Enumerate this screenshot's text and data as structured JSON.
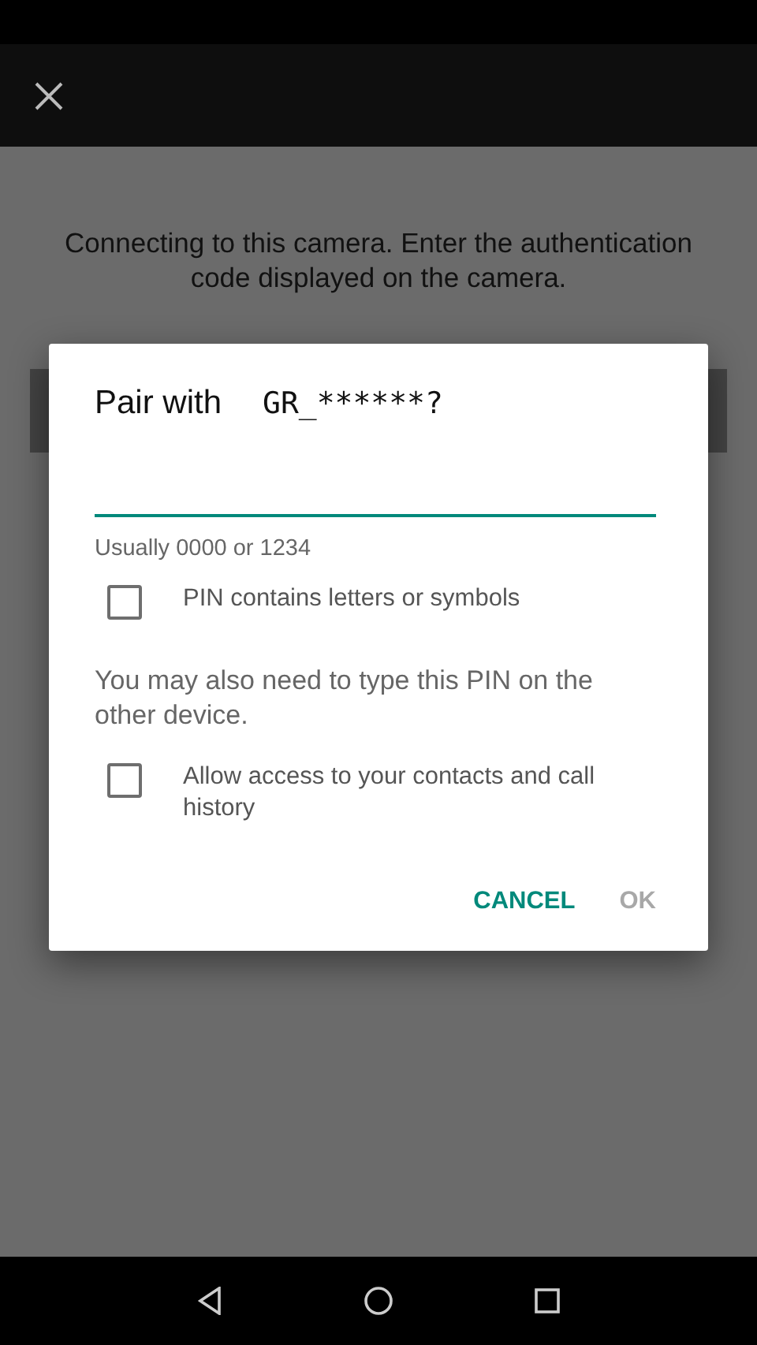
{
  "message": "Connecting to this camera. Enter the authentication code displayed on the camera.",
  "dialog": {
    "title": "Pair with",
    "device": "GR_******?",
    "hint": "Usually 0000 or 1234",
    "options": [
      {
        "label": "PIN contains letters or symbols",
        "checked": false
      },
      {
        "kind": "note",
        "label": "You may also need to type this PIN on the other device."
      },
      {
        "label": "Allow access to your contacts and call history",
        "checked": false
      }
    ],
    "buttons": [
      {
        "label": "CANCEL",
        "disabled": false
      },
      {
        "label": "OK",
        "disabled": true
      }
    ]
  }
}
